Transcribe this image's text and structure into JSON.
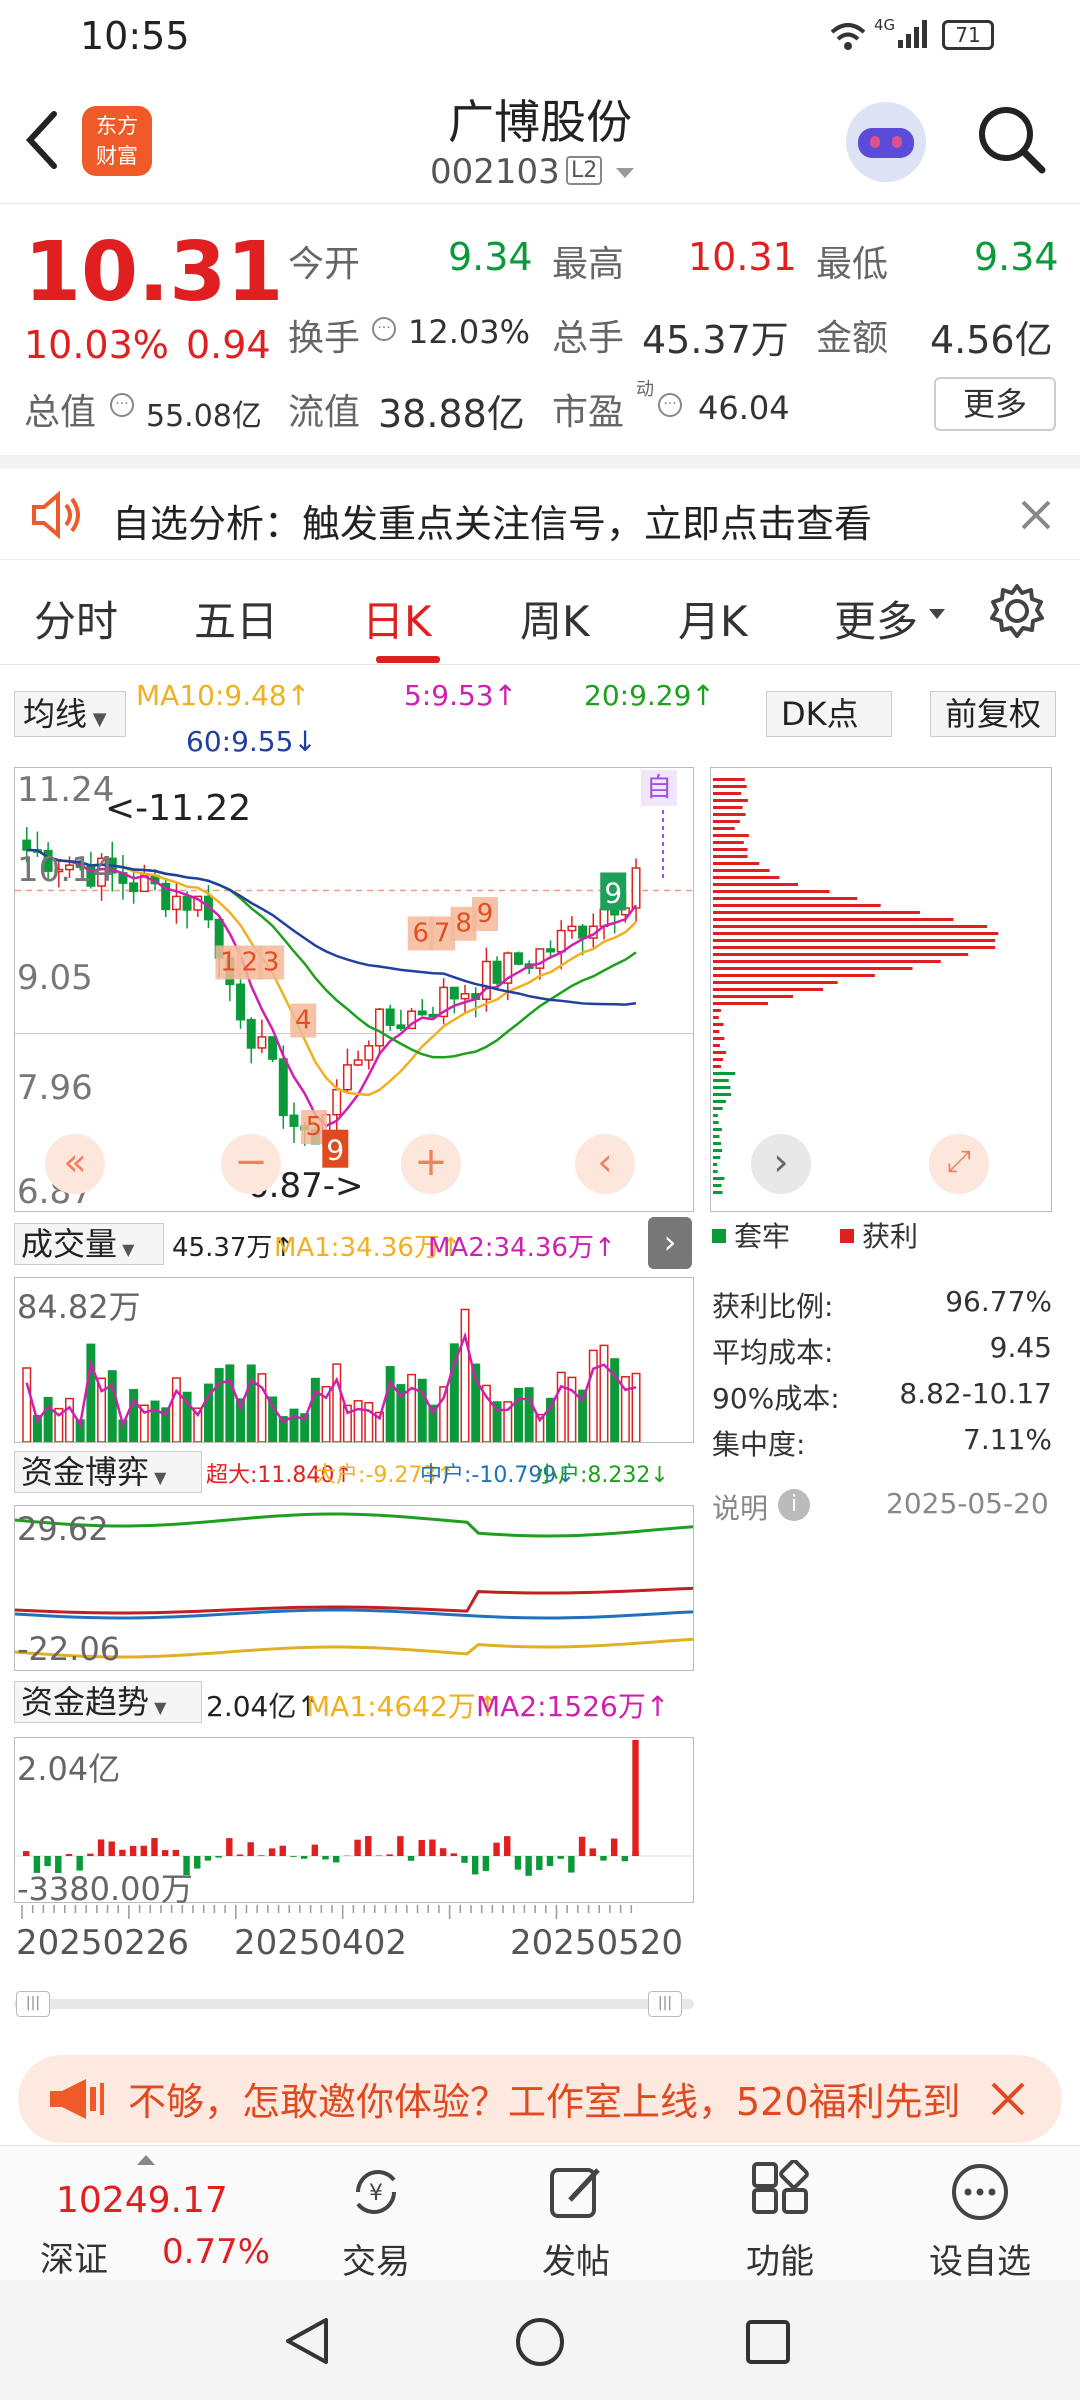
{
  "status": {
    "time": "10:55",
    "network": "4G",
    "battery": "71"
  },
  "header": {
    "logo_line1": "东方",
    "logo_line2": "财富",
    "title": "广博股份",
    "code": "002103",
    "level": "L2"
  },
  "quote": {
    "price": "10.31",
    "change_pct": "10.03%",
    "change_amt": "0.94",
    "open_label": "今开",
    "open": "9.34",
    "high_label": "最高",
    "high": "10.31",
    "low_label": "最低",
    "low": "9.34",
    "turnover_label": "换手",
    "turnover": "12.03%",
    "volume_label": "总手",
    "volume": "45.37万",
    "amount_label": "金额",
    "amount": "4.56亿",
    "mktcap_label": "总值",
    "mktcap": "55.08亿",
    "float_label": "流值",
    "float": "38.88亿",
    "pe_label": "市盈",
    "pe_sup": "动",
    "pe": "46.04",
    "more": "更多"
  },
  "alert": {
    "text": "自选分析：触发重点关注信号，立即点击查看"
  },
  "tabs": [
    "分时",
    "五日",
    "日K",
    "周K",
    "月K",
    "更多"
  ],
  "active_tab": 2,
  "kchart": {
    "ma_select": "均线",
    "ma10": "MA10:9.48↑",
    "ma5": "5:9.53↑",
    "ma20": "20:9.29↑",
    "ma60": "60:9.55↓",
    "dk": "DK点",
    "adjust": "前复权",
    "y_labels": [
      "11.24",
      "10.14",
      "9.05",
      "7.96",
      "6.87"
    ],
    "high_note": "<-11.22",
    "low_note": "6.87->",
    "self_tag": "自",
    "signal_nums": [
      "1",
      "2",
      "3",
      "4",
      "5",
      "6",
      "7",
      "8",
      "9"
    ]
  },
  "chip": {
    "legend_trapped": "套牢",
    "legend_profit": "获利",
    "rows": [
      {
        "label": "获利比例:",
        "value": "96.77%"
      },
      {
        "label": "平均成本:",
        "value": "9.45"
      },
      {
        "label": "90%成本:",
        "value": "8.82-10.17"
      },
      {
        "label": "集中度:",
        "value": "7.11%"
      }
    ],
    "note": "说明",
    "date": "2025-05-20"
  },
  "volume": {
    "label": "成交量",
    "value": "45.37万↑",
    "ma1": "MA1:34.36万↑",
    "ma2": "MA2:34.36万↑",
    "max": "84.82万"
  },
  "fund": {
    "label": "资金博弈",
    "super": "超大:11.840↑",
    "big": "大户:-9.273↑",
    "mid": "中户:-10.799↓",
    "small": "小户:8.232↓",
    "max": "29.62",
    "min": "-22.06"
  },
  "trend": {
    "label": "资金趋势",
    "value": "2.04亿↑",
    "ma1": "MA1:4642万↑",
    "ma2": "MA2:1526万↑",
    "max": "2.04亿",
    "min": "-3380.00万"
  },
  "dates": [
    "20250226",
    "20250402",
    "20250520"
  ],
  "banner": {
    "text": "不够，怎敢邀你体验？工作室上线，520福利先到"
  },
  "bottom": {
    "index_value": "10249.17",
    "index_name": "深证",
    "index_pct": "0.77%",
    "trade": "交易",
    "post": "发帖",
    "func": "功能",
    "add": "设自选"
  },
  "colors": {
    "up": "#e02020",
    "down": "#0b9a3a",
    "ma5": "#d020b0",
    "ma10": "#f0b020",
    "ma20": "#1ea01e",
    "ma60": "#2040a0"
  }
}
